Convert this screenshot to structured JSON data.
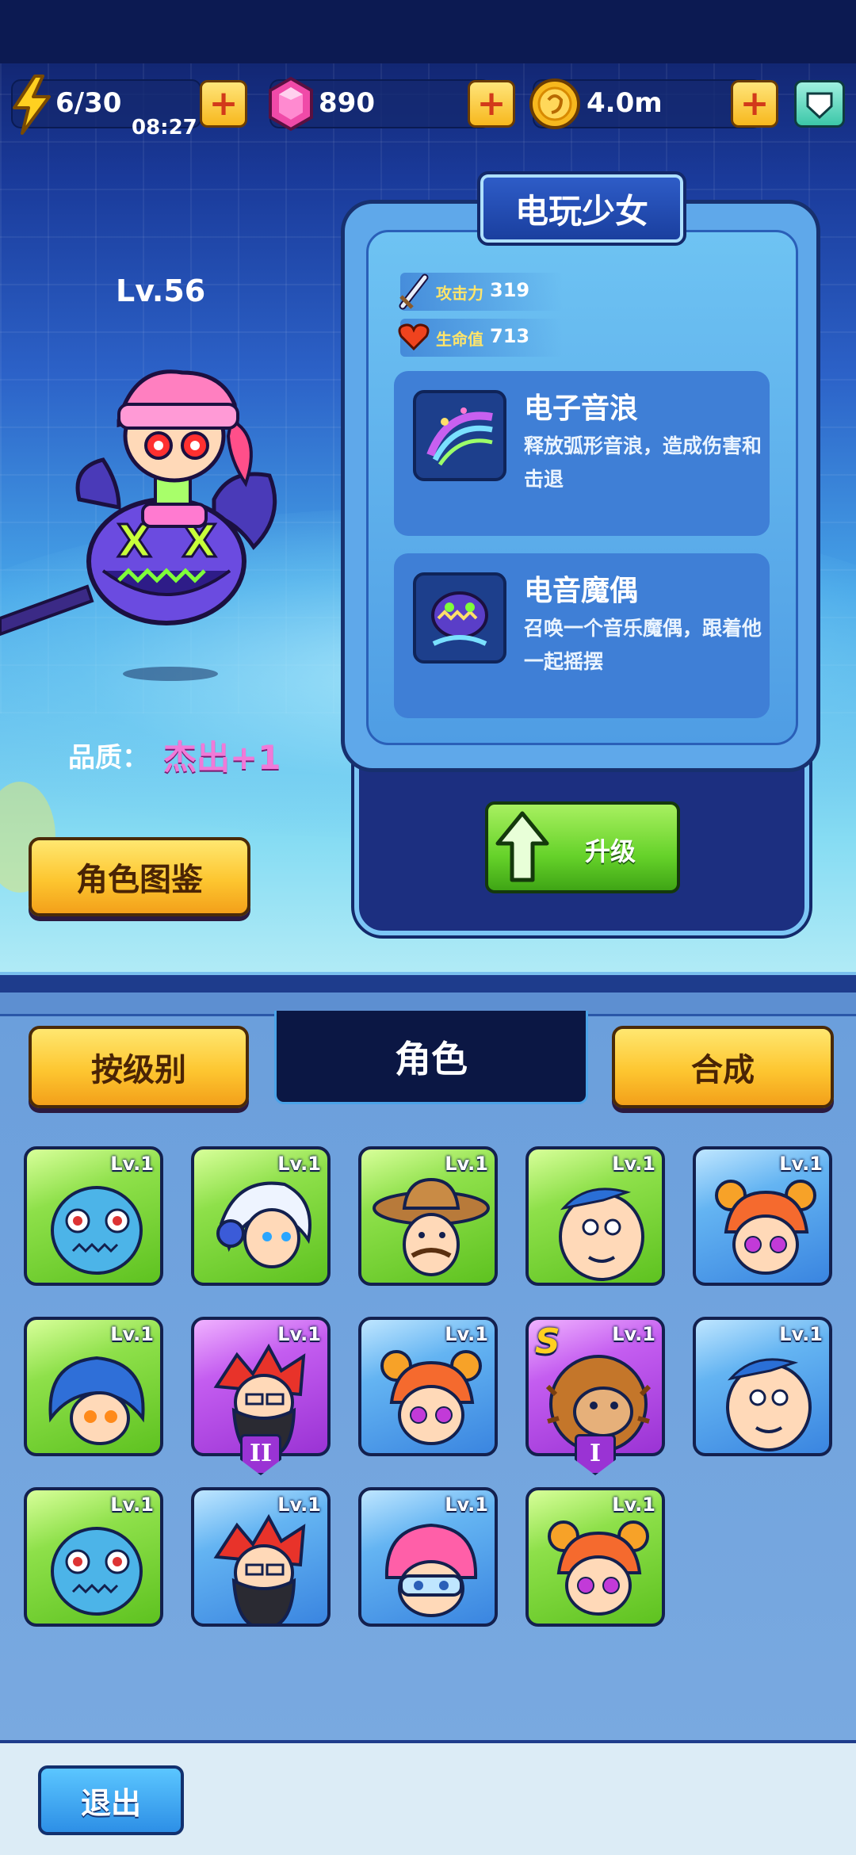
{
  "resources": {
    "energy": "6/30",
    "energy_timer": "08:27",
    "gems": "890",
    "coins": "4.0m",
    "plus": "+"
  },
  "hero": {
    "level": "Lv.56",
    "quality_label": "品质：",
    "quality_value": "杰出+1",
    "codex_button": "角色图鉴"
  },
  "card": {
    "title": "电玩少女",
    "stats": [
      {
        "label": "攻击力",
        "value": "319"
      },
      {
        "label": "生命值",
        "value": "713"
      }
    ],
    "skills": [
      {
        "name": "电子音浪",
        "desc": "释放弧形音浪，造成伤害和击退"
      },
      {
        "name": "电音魔偶",
        "desc": "召唤一个音乐魔偶，跟着他一起摇摆"
      }
    ],
    "upgrade_button": "升级"
  },
  "tabs": {
    "by_level": "按级别",
    "characters": "角色",
    "combine": "合成"
  },
  "roster": [
    {
      "level": "Lv.1",
      "frame": "green",
      "portrait": "blue-fish-monster-icon"
    },
    {
      "level": "Lv.1",
      "frame": "green",
      "portrait": "white-hair-headset-girl-icon"
    },
    {
      "level": "Lv.1",
      "frame": "green",
      "portrait": "cowboy-hat-man-icon"
    },
    {
      "level": "Lv.1",
      "frame": "green",
      "portrait": "bald-chubby-man-icon"
    },
    {
      "level": "Lv.1",
      "frame": "blue",
      "portrait": "orange-hair-bun-girl-icon"
    },
    {
      "level": "Lv.1",
      "frame": "green",
      "portrait": "blue-hood-girl-icon"
    },
    {
      "level": "Lv.1",
      "frame": "purple",
      "portrait": "red-hair-bearded-man-icon",
      "rank": "II"
    },
    {
      "level": "Lv.1",
      "frame": "blue",
      "portrait": "orange-hair-bun-girl-icon"
    },
    {
      "level": "Lv.1",
      "frame": "purple",
      "portrait": "lion-mane-monkey-icon",
      "rank": "I",
      "badge": "S"
    },
    {
      "level": "Lv.1",
      "frame": "blue",
      "portrait": "bald-chubby-man-icon"
    },
    {
      "level": "Lv.1",
      "frame": "green",
      "portrait": "blue-fish-monster-icon"
    },
    {
      "level": "Lv.1",
      "frame": "blue",
      "portrait": "red-hair-bearded-man-icon"
    },
    {
      "level": "Lv.1",
      "frame": "blue",
      "portrait": "pink-hair-goggles-girl-icon"
    },
    {
      "level": "Lv.1",
      "frame": "green",
      "portrait": "orange-hair-bun-girl-icon"
    }
  ],
  "exit_button": "退出",
  "colors": {
    "accent_yellow": "#fdc630",
    "upgrade_green": "#66d22a",
    "quality_pink": "#f07ad8",
    "panel_blue": "#6b9fdc"
  }
}
